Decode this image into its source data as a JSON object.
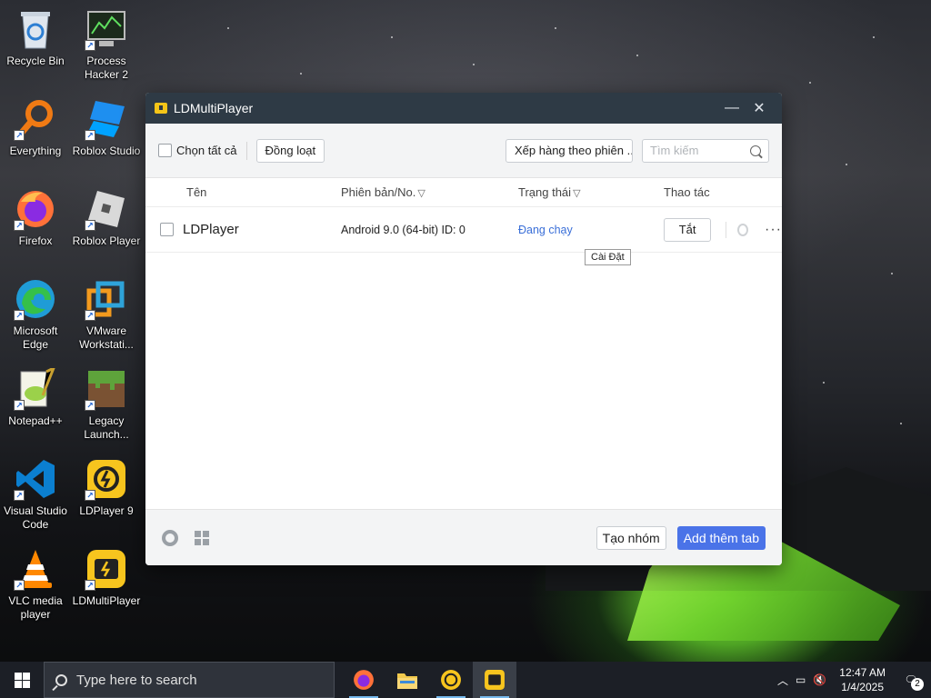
{
  "desktop": {
    "icons": [
      {
        "label": "Recycle Bin"
      },
      {
        "label": "Process Hacker 2"
      },
      {
        "label": "Everything"
      },
      {
        "label": "Roblox Studio"
      },
      {
        "label": "Firefox"
      },
      {
        "label": "Roblox Player"
      },
      {
        "label": "Microsoft Edge"
      },
      {
        "label": "VMware Workstati..."
      },
      {
        "label": "Notepad++"
      },
      {
        "label": "Legacy Launch..."
      },
      {
        "label": "Visual Studio Code"
      },
      {
        "label": "LDPlayer 9"
      },
      {
        "label": "VLC media player"
      },
      {
        "label": "LDMultiPlayer"
      }
    ]
  },
  "window": {
    "title": "LDMultiPlayer",
    "minimize_glyph": "—",
    "close_glyph": "✕"
  },
  "toolbar": {
    "select_all_label": "Chọn tất cả",
    "batch_label": "Đồng loạt",
    "sort_label": "Xếp hàng theo phiên ...",
    "search_placeholder": "Tìm kiếm"
  },
  "table": {
    "headers": {
      "name": "Tên",
      "version": "Phiên bản/No.",
      "status": "Trạng thái",
      "action": "Thao tác"
    },
    "rows": [
      {
        "name": "LDPlayer",
        "version": "Android 9.0 (64-bit) ID: 0",
        "status": "Đang chạy",
        "action_label": "Tắt",
        "more_glyph": "···"
      }
    ],
    "tooltip": "Cài Đặt"
  },
  "footer": {
    "create_group_label": "Tạo nhóm",
    "add_tab_label": "Add thêm tab"
  },
  "taskbar": {
    "search_placeholder": "Type here to search",
    "time": "12:47 AM",
    "date": "1/4/2025",
    "notification_count": "2"
  },
  "colors": {
    "accent": "#4a73e8",
    "status_running": "#3a6fd8",
    "titlebar": "#2e3a45"
  }
}
